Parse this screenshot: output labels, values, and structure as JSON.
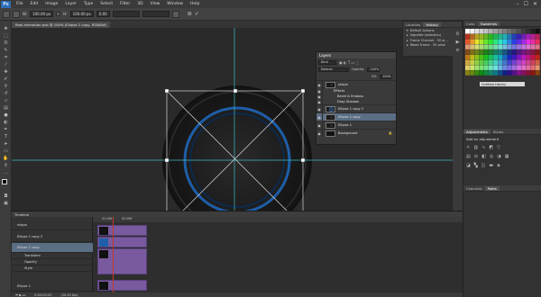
{
  "app": {
    "logo": "Ps"
  },
  "menu": [
    "File",
    "Edit",
    "Image",
    "Layer",
    "Type",
    "Select",
    "Filter",
    "3D",
    "View",
    "Window",
    "Help"
  ],
  "window_buttons": [
    "–",
    "☐",
    "✕"
  ],
  "options": {
    "w_label": "W:",
    "w_value": "100.00 px",
    "h_label": "H:",
    "h_value": "100.00 px",
    "angle_value": "0.00",
    "commit_icon": "✓",
    "cancel_icon": "⊘"
  },
  "document": {
    "tab_title": "Real animation psd @ 100% (Ellipse 1 copy, RGB/8#)"
  },
  "history": {
    "tabs": [
      "Libraries",
      "History"
    ],
    "rows": [
      "Default Actions",
      "Vignette (selection)",
      "Frame Channel - 50 pi…",
      "Wood Frame - 50 pixel"
    ]
  },
  "layers_panel": {
    "title": "Layers",
    "kind_label": "Kind",
    "blend_mode": "Normal",
    "opacity_label": "Opacity:",
    "opacity_value": "100%",
    "fill_label": "Fill:",
    "fill_value": "100%",
    "rows": [
      {
        "name": "shape",
        "selected": false,
        "sub": false
      },
      {
        "name": "Effects",
        "selected": false,
        "sub": true
      },
      {
        "name": "Bevel & Emboss",
        "selected": false,
        "sub": true
      },
      {
        "name": "Drop Shadow",
        "selected": false,
        "sub": true
      },
      {
        "name": "Ellipse 1 copy 2",
        "selected": false,
        "sub": false
      },
      {
        "name": "Ellipse 1 copy",
        "selected": true,
        "sub": false
      },
      {
        "name": "Ellipse 1",
        "selected": false,
        "sub": false
      },
      {
        "name": "Background",
        "selected": false,
        "sub": false
      }
    ]
  },
  "right_panels": {
    "color_tabs": [
      "Color",
      "Swatches"
    ],
    "library_select": "Untitled Library",
    "adjust_tabs": [
      "Adjustments",
      "Styles"
    ],
    "adjust_title": "Add an adjustment",
    "channel_tabs": [
      "Channels",
      "Paths"
    ]
  },
  "timeline": {
    "title": "Timeline",
    "ruler_labels": [
      "01:00f",
      "02:00f"
    ],
    "tracks": [
      {
        "name": "shape",
        "selected": false
      },
      {
        "name": "Ellipse 1 copy 2",
        "selected": false
      },
      {
        "name": "Ellipse 1 copy",
        "selected": true
      },
      {
        "name": "Transform",
        "selected": false
      },
      {
        "name": "Opacity",
        "selected": false
      },
      {
        "name": "Style",
        "selected": false
      },
      {
        "name": "Ellipse 1",
        "selected": false
      }
    ],
    "footer_time": "0:00:00:03",
    "footer_fps": "(30.00 fps)"
  }
}
